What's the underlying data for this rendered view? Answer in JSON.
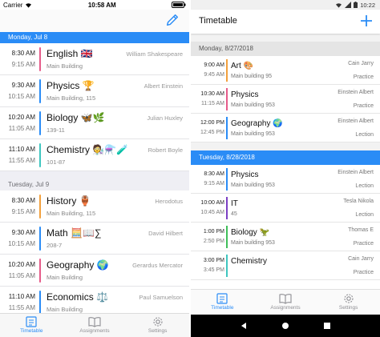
{
  "ios": {
    "status": {
      "carrier": "Carrier",
      "time": "10:58 AM"
    },
    "days": [
      {
        "label": "Monday, Jul 8",
        "active": true,
        "lessons": [
          {
            "start": "8:30 AM",
            "end": "9:15 AM",
            "subject": "English 🇬🇧",
            "teacher": "William Shakespeare",
            "room": "Main Building",
            "color": "#e65b8a"
          },
          {
            "start": "9:30 AM",
            "end": "10:15 AM",
            "subject": "Physics 🏆",
            "teacher": "Albert Einstein",
            "room": "Main Building, 115",
            "color": "#2a8cf6"
          },
          {
            "start": "10:20 AM",
            "end": "11:05 AM",
            "subject": "Biology 🦋🌿",
            "teacher": "Julian Huxley",
            "room": "139-11",
            "color": "#2a8cf6"
          },
          {
            "start": "11:10 AM",
            "end": "11:55 AM",
            "subject": "Chemistry 🧑‍🔬⚗️🧪",
            "teacher": "Robert Boyle",
            "room": "101-87",
            "color": "#3ec6c0"
          }
        ]
      },
      {
        "label": "Tuesday, Jul 9",
        "active": false,
        "lessons": [
          {
            "start": "8:30 AM",
            "end": "9:15 AM",
            "subject": "History 🏺",
            "teacher": "Herodotus",
            "room": "Main Building, 115",
            "color": "#f2a03d"
          },
          {
            "start": "9:30 AM",
            "end": "10:15 AM",
            "subject": "Math 🧮📖∑",
            "teacher": "David Hilbert",
            "room": "208-7",
            "color": "#2a8cf6"
          },
          {
            "start": "10:20 AM",
            "end": "11:05 AM",
            "subject": "Geography 🌍",
            "teacher": "Gerardus Mercator",
            "room": "Main Building",
            "color": "#e65b8a"
          },
          {
            "start": "11:10 AM",
            "end": "11:55 AM",
            "subject": "Economics ⚖️",
            "teacher": "Paul Samuelson",
            "room": "Main Building",
            "color": "#2a8cf6"
          }
        ]
      }
    ],
    "tabs": [
      {
        "label": "Timetable",
        "active": true
      },
      {
        "label": "Assignments",
        "active": false
      },
      {
        "label": "Settings",
        "active": false
      }
    ]
  },
  "android": {
    "status": {
      "time": "10:22"
    },
    "title": "Timetable",
    "days": [
      {
        "label": "Monday, 8/27/2018",
        "active": false,
        "lessons": [
          {
            "start": "9:00 AM",
            "end": "9:45 AM",
            "subject": "Art 🎨",
            "teacher": "Cain Jarry",
            "room": "Main building 95",
            "type": "Practice",
            "color": "#f2a03d"
          },
          {
            "start": "10:30 AM",
            "end": "11:15 AM",
            "subject": "Physics",
            "teacher": "Einstein Albert",
            "room": "Main building 953",
            "type": "Practice",
            "color": "#e65b8a"
          },
          {
            "start": "12:00 PM",
            "end": "12:45 PM",
            "subject": "Geography 🌍",
            "teacher": "Einstein Albert",
            "room": "Main building 953",
            "type": "Lection",
            "color": "#2a8cf6"
          }
        ]
      },
      {
        "label": "Tuesday, 8/28/2018",
        "active": true,
        "lessons": [
          {
            "start": "8:30 AM",
            "end": "9:15 AM",
            "subject": "Physics",
            "teacher": "Einstein Albert",
            "room": "Main building 953",
            "type": "Lection",
            "color": "#2a8cf6"
          },
          {
            "start": "10:00 AM",
            "end": "10:45 AM",
            "subject": "IT",
            "teacher": "Tesla Nikola",
            "room": "45",
            "type": "Lection",
            "color": "#7b3fc4"
          },
          {
            "start": "1:00 PM",
            "end": "2:50 PM",
            "subject": "Biology 🦖",
            "teacher": "Thomas E",
            "room": "Main building 953",
            "type": "Practice",
            "color": "#3fbf5a"
          },
          {
            "start": "3:00 PM",
            "end": "3:45 PM",
            "subject": "Chemistry",
            "teacher": "Cain Jarry",
            "room": "",
            "type": "Practice",
            "color": "#3ec6c0"
          }
        ]
      }
    ],
    "tabs": [
      {
        "label": "Timetable",
        "active": true
      },
      {
        "label": "Assignments",
        "active": false
      },
      {
        "label": "Settings",
        "active": false
      }
    ]
  },
  "colors": {
    "accent": "#2a8cf6",
    "inactive_tab": "#8e8e93"
  }
}
